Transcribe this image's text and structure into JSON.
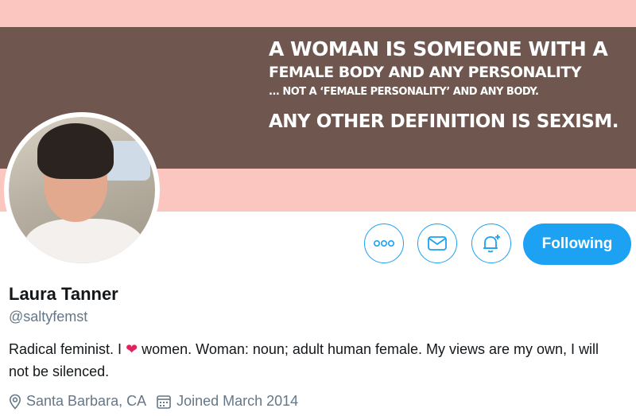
{
  "banner": {
    "line1": "A WOMAN IS SOMEONE WITH A",
    "line2": "FEMALE BODY AND ANY PERSONALITY",
    "line3": "... NOT A ‘FEMALE PERSONALITY’ AND ANY BODY.",
    "line4": "ANY OTHER DEFINITION IS SEXISM.",
    "colors": {
      "pink": "#fbc6c0",
      "brown": "#6f5750"
    }
  },
  "actions": {
    "more_icon": "more-icon",
    "message_icon": "envelope-icon",
    "notify_icon": "bell-plus-icon",
    "follow_label": "Following",
    "accent": "#1da1f2"
  },
  "profile": {
    "name": "Laura Tanner",
    "handle": "@saltyfemst",
    "bio_before": "Radical feminist. I ",
    "bio_heart": "❤",
    "bio_after": " women. Woman: noun; adult human female. My views are my own, I will not be silenced.",
    "location": "Santa Barbara, CA",
    "joined": "Joined March 2014"
  }
}
